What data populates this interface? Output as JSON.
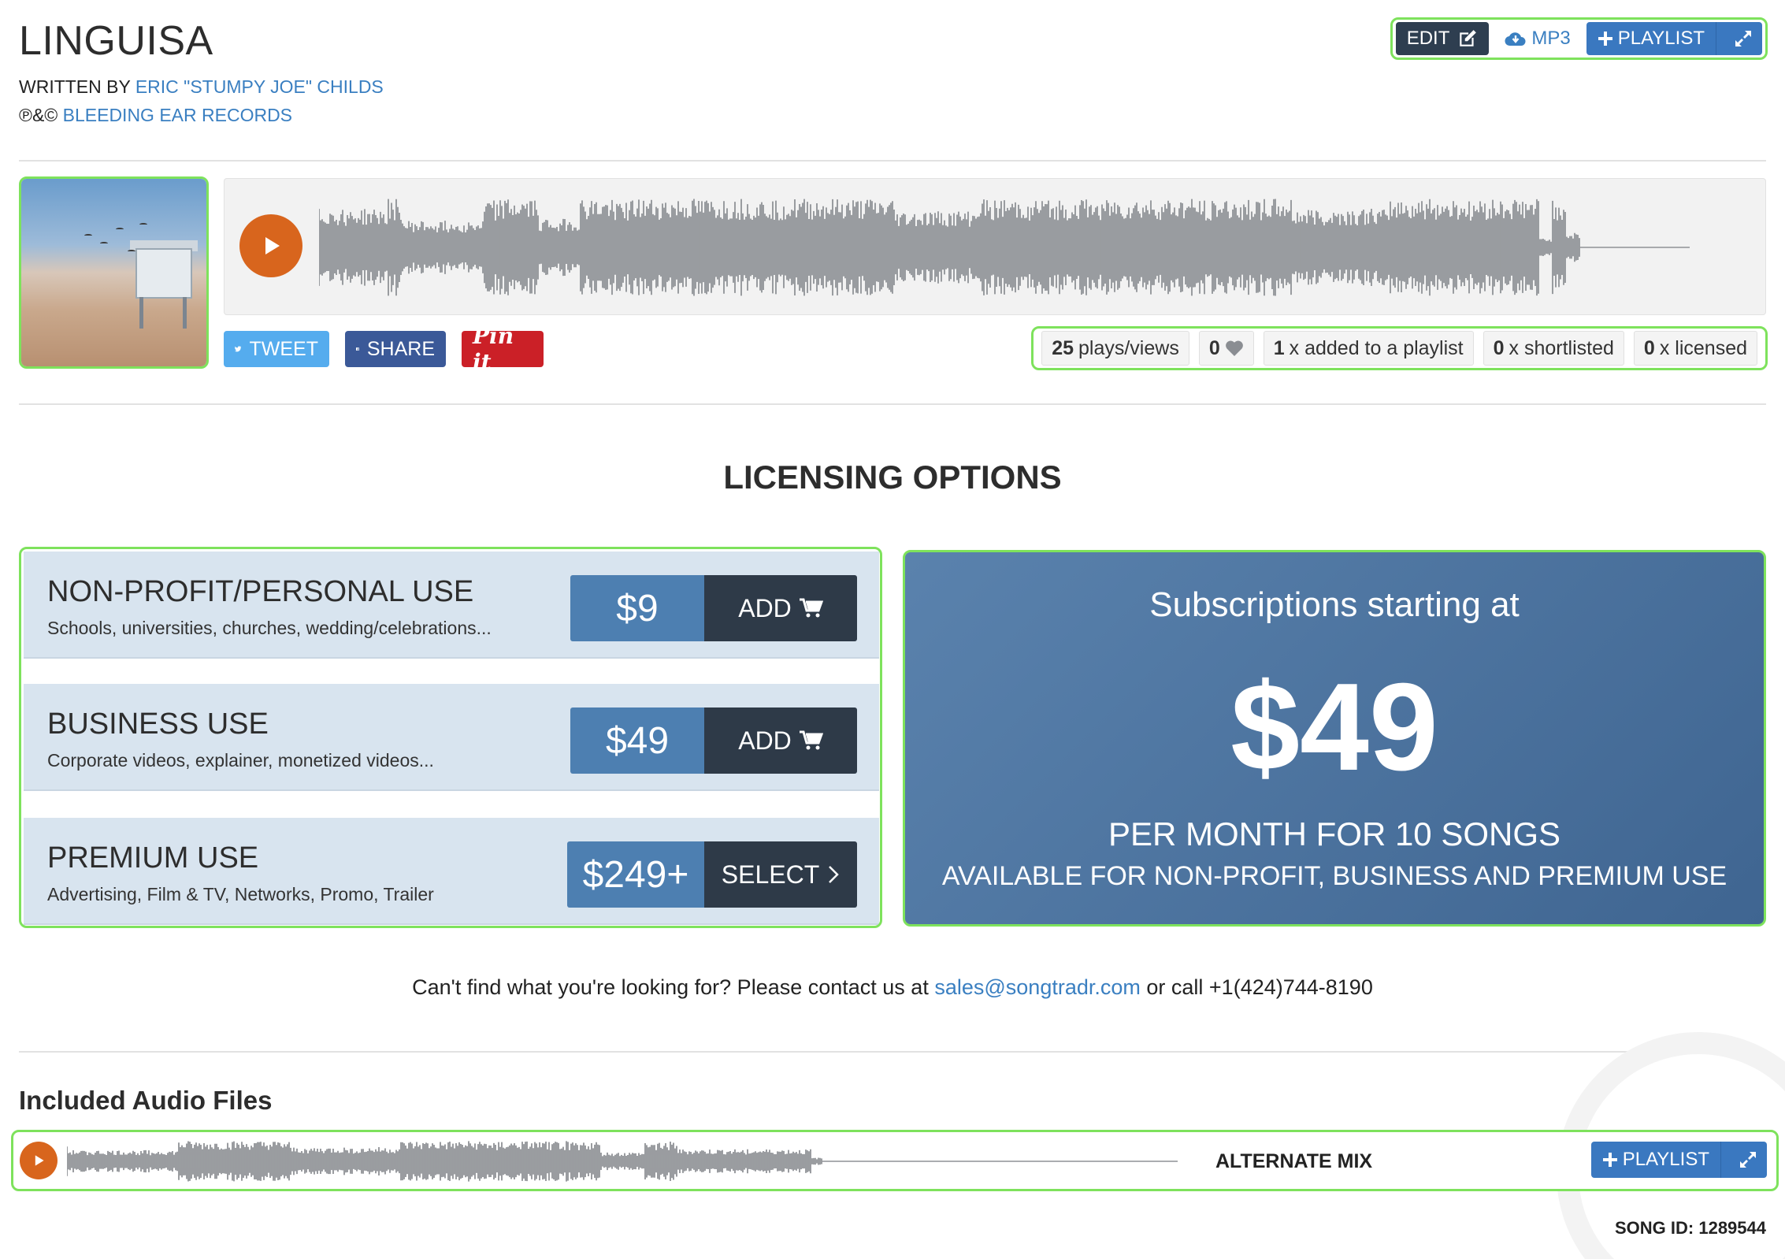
{
  "song": {
    "title": "LINGUISA",
    "written_by_label": "WRITTEN BY",
    "writer": "ERIC \"STUMPY JOE\" CHILDS",
    "copyright_label": "℗&©",
    "label": "BLEEDING EAR RECORDS"
  },
  "toolbar": {
    "edit_label": "EDIT",
    "mp3_label": "MP3",
    "playlist_label": "PLAYLIST"
  },
  "share": {
    "tweet_label": "TWEET",
    "share_label": "SHARE",
    "pin_label": "Pin it"
  },
  "stats": {
    "plays_count": "25",
    "plays_label": "plays/views",
    "likes_count": "0",
    "playlist_count": "1",
    "playlist_label": "x added to a playlist",
    "shortlisted_count": "0",
    "shortlisted_label": "x shortlisted",
    "licensed_count": "0",
    "licensed_label": "x licensed"
  },
  "licensing": {
    "title": "LICENSING OPTIONS",
    "options": [
      {
        "name": "NON-PROFIT/PERSONAL USE",
        "description": "Schools, universities, churches, wedding/celebrations...",
        "price": "$9",
        "action": "ADD"
      },
      {
        "name": "BUSINESS USE",
        "description": "Corporate videos, explainer, monetized videos...",
        "price": "$49",
        "action": "ADD"
      },
      {
        "name": "PREMIUM USE",
        "description": "Advertising, Film & TV, Networks, Promo, Trailer",
        "price": "$249+",
        "action": "SELECT"
      }
    ]
  },
  "subscription": {
    "heading": "Subscriptions starting at",
    "price": "$49",
    "line1": "PER MONTH FOR 10 SONGS",
    "line2": "AVAILABLE FOR NON-PROFIT, BUSINESS AND PREMIUM USE"
  },
  "contact": {
    "text_before": "Can't find what you're looking for? Please contact us at",
    "email": "sales@songtradr.com",
    "text_after": "or call +1(424)744-8190"
  },
  "included": {
    "title": "Included Audio Files",
    "files": [
      {
        "name": "ALTERNATE MIX",
        "playlist_label": "PLAYLIST"
      }
    ]
  },
  "footer": {
    "song_id_label": "SONG ID:",
    "song_id": "1289544"
  },
  "colors": {
    "accent_blue": "#3a78c0",
    "dark_navy": "#2e3a48",
    "play_orange": "#d8651d",
    "highlight_green": "#7ee25c",
    "waveform_gray": "#8f9296"
  },
  "icons": {
    "edit": "edit-icon",
    "download": "cloud-download-icon",
    "plus": "plus-icon",
    "expand": "expand-icon",
    "play": "play-icon",
    "twitter": "twitter-icon",
    "facebook": "facebook-icon",
    "heart": "heart-icon",
    "cart": "cart-icon",
    "chevron": "chevron-right-icon"
  }
}
